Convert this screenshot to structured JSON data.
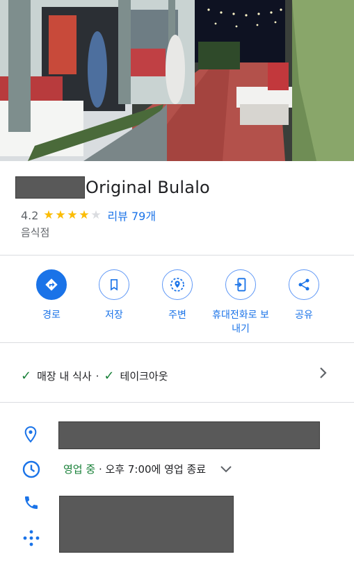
{
  "hero_alt": "Restaurant exterior photo",
  "place": {
    "name": "Original Bulalo",
    "rating": "4.2",
    "stars": [
      1,
      1,
      1,
      1,
      0.2
    ],
    "reviews": "리뷰 79개",
    "category": "음식점"
  },
  "actions": [
    {
      "label": "경로",
      "icon": "directions-icon"
    },
    {
      "label": "저장",
      "icon": "bookmark-icon"
    },
    {
      "label": "주변",
      "icon": "nearby-icon"
    },
    {
      "label": "휴대전화로 보\n내기",
      "icon": "send-to-phone-icon"
    },
    {
      "label": "공유",
      "icon": "share-icon"
    }
  ],
  "service_options": {
    "dine_in": "매장 내 식사",
    "separator": "·",
    "takeout": "테이크아웃"
  },
  "hours": {
    "status": "영업 중",
    "detail": " · 오후 7:00에 영업 종료"
  },
  "colors": {
    "accent": "#1a73e8",
    "open": "#188038",
    "star": "#fbbc04"
  }
}
